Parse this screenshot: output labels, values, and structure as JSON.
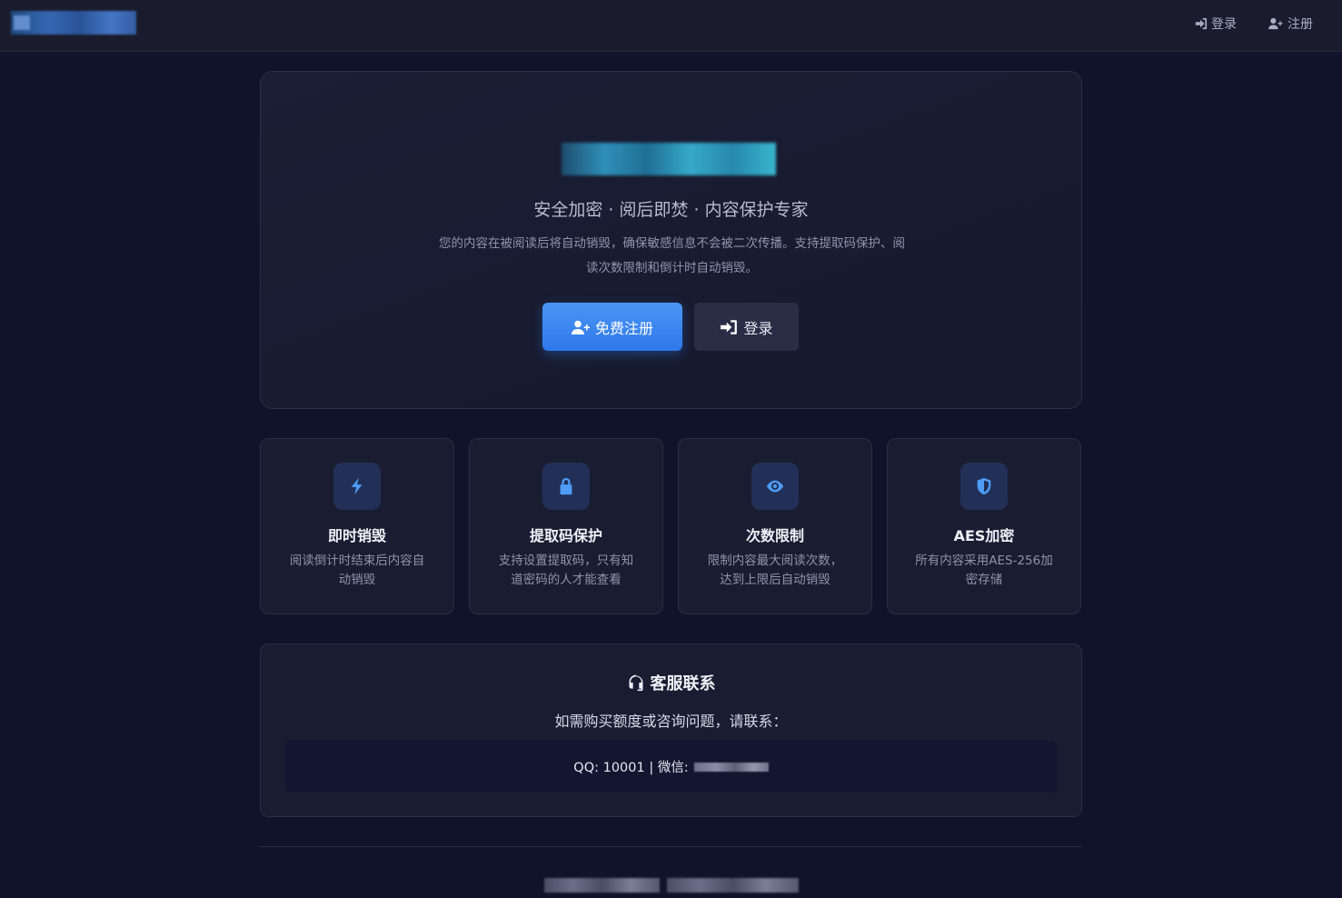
{
  "header": {
    "login_label": "登录",
    "register_label": "注册"
  },
  "hero": {
    "subtitle": "安全加密 · 阅后即焚 · 内容保护专家",
    "description": "您的内容在被阅读后将自动销毁，确保敏感信息不会被二次传播。支持提取码保护、阅读次数限制和倒计时自动销毁。",
    "register_button": "免费注册",
    "login_button": "登录"
  },
  "features": [
    {
      "icon": "lightning-icon",
      "title": "即时销毁",
      "desc": "阅读倒计时结束后内容自动销毁"
    },
    {
      "icon": "lock-icon",
      "title": "提取码保护",
      "desc": "支持设置提取码，只有知道密码的人才能查看"
    },
    {
      "icon": "eye-icon",
      "title": "次数限制",
      "desc": "限制内容最大阅读次数，达到上限后自动销毁"
    },
    {
      "icon": "shield-icon",
      "title": "AES加密",
      "desc": "所有内容采用AES-256加密存储"
    }
  ],
  "support": {
    "title": "客服联系",
    "line": "如需购买额度或咨询问题，请联系：",
    "contact_text": "QQ: 10001 | 微信:"
  },
  "colors": {
    "background": "#11132a",
    "card": "#1a1d31",
    "accent": "#4f9cf7",
    "primary_button": "#3a86f0"
  }
}
